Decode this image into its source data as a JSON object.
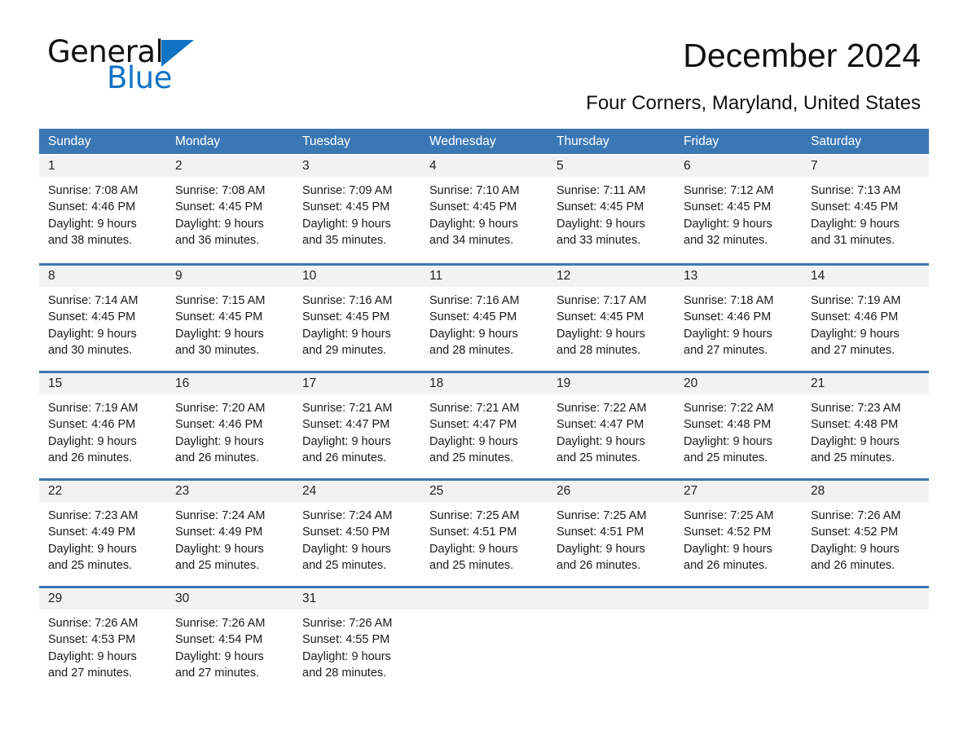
{
  "brand": {
    "name_top": "General",
    "name_bottom": "Blue",
    "accent_color": "#1273c4"
  },
  "header": {
    "title": "December 2024",
    "subtitle": "Four Corners, Maryland, United States"
  },
  "calendar": {
    "header_color": "#3b77b4",
    "daynum_bg": "#f2f2f2",
    "day_names": [
      "Sunday",
      "Monday",
      "Tuesday",
      "Wednesday",
      "Thursday",
      "Friday",
      "Saturday"
    ],
    "weeks": [
      [
        {
          "day": "1",
          "sunrise": "Sunrise: 7:08 AM",
          "sunset": "Sunset: 4:46 PM",
          "daylight_line1": "Daylight: 9 hours",
          "daylight_line2": "and 38 minutes."
        },
        {
          "day": "2",
          "sunrise": "Sunrise: 7:08 AM",
          "sunset": "Sunset: 4:45 PM",
          "daylight_line1": "Daylight: 9 hours",
          "daylight_line2": "and 36 minutes."
        },
        {
          "day": "3",
          "sunrise": "Sunrise: 7:09 AM",
          "sunset": "Sunset: 4:45 PM",
          "daylight_line1": "Daylight: 9 hours",
          "daylight_line2": "and 35 minutes."
        },
        {
          "day": "4",
          "sunrise": "Sunrise: 7:10 AM",
          "sunset": "Sunset: 4:45 PM",
          "daylight_line1": "Daylight: 9 hours",
          "daylight_line2": "and 34 minutes."
        },
        {
          "day": "5",
          "sunrise": "Sunrise: 7:11 AM",
          "sunset": "Sunset: 4:45 PM",
          "daylight_line1": "Daylight: 9 hours",
          "daylight_line2": "and 33 minutes."
        },
        {
          "day": "6",
          "sunrise": "Sunrise: 7:12 AM",
          "sunset": "Sunset: 4:45 PM",
          "daylight_line1": "Daylight: 9 hours",
          "daylight_line2": "and 32 minutes."
        },
        {
          "day": "7",
          "sunrise": "Sunrise: 7:13 AM",
          "sunset": "Sunset: 4:45 PM",
          "daylight_line1": "Daylight: 9 hours",
          "daylight_line2": "and 31 minutes."
        }
      ],
      [
        {
          "day": "8",
          "sunrise": "Sunrise: 7:14 AM",
          "sunset": "Sunset: 4:45 PM",
          "daylight_line1": "Daylight: 9 hours",
          "daylight_line2": "and 30 minutes."
        },
        {
          "day": "9",
          "sunrise": "Sunrise: 7:15 AM",
          "sunset": "Sunset: 4:45 PM",
          "daylight_line1": "Daylight: 9 hours",
          "daylight_line2": "and 30 minutes."
        },
        {
          "day": "10",
          "sunrise": "Sunrise: 7:16 AM",
          "sunset": "Sunset: 4:45 PM",
          "daylight_line1": "Daylight: 9 hours",
          "daylight_line2": "and 29 minutes."
        },
        {
          "day": "11",
          "sunrise": "Sunrise: 7:16 AM",
          "sunset": "Sunset: 4:45 PM",
          "daylight_line1": "Daylight: 9 hours",
          "daylight_line2": "and 28 minutes."
        },
        {
          "day": "12",
          "sunrise": "Sunrise: 7:17 AM",
          "sunset": "Sunset: 4:45 PM",
          "daylight_line1": "Daylight: 9 hours",
          "daylight_line2": "and 28 minutes."
        },
        {
          "day": "13",
          "sunrise": "Sunrise: 7:18 AM",
          "sunset": "Sunset: 4:46 PM",
          "daylight_line1": "Daylight: 9 hours",
          "daylight_line2": "and 27 minutes."
        },
        {
          "day": "14",
          "sunrise": "Sunrise: 7:19 AM",
          "sunset": "Sunset: 4:46 PM",
          "daylight_line1": "Daylight: 9 hours",
          "daylight_line2": "and 27 minutes."
        }
      ],
      [
        {
          "day": "15",
          "sunrise": "Sunrise: 7:19 AM",
          "sunset": "Sunset: 4:46 PM",
          "daylight_line1": "Daylight: 9 hours",
          "daylight_line2": "and 26 minutes."
        },
        {
          "day": "16",
          "sunrise": "Sunrise: 7:20 AM",
          "sunset": "Sunset: 4:46 PM",
          "daylight_line1": "Daylight: 9 hours",
          "daylight_line2": "and 26 minutes."
        },
        {
          "day": "17",
          "sunrise": "Sunrise: 7:21 AM",
          "sunset": "Sunset: 4:47 PM",
          "daylight_line1": "Daylight: 9 hours",
          "daylight_line2": "and 26 minutes."
        },
        {
          "day": "18",
          "sunrise": "Sunrise: 7:21 AM",
          "sunset": "Sunset: 4:47 PM",
          "daylight_line1": "Daylight: 9 hours",
          "daylight_line2": "and 25 minutes."
        },
        {
          "day": "19",
          "sunrise": "Sunrise: 7:22 AM",
          "sunset": "Sunset: 4:47 PM",
          "daylight_line1": "Daylight: 9 hours",
          "daylight_line2": "and 25 minutes."
        },
        {
          "day": "20",
          "sunrise": "Sunrise: 7:22 AM",
          "sunset": "Sunset: 4:48 PM",
          "daylight_line1": "Daylight: 9 hours",
          "daylight_line2": "and 25 minutes."
        },
        {
          "day": "21",
          "sunrise": "Sunrise: 7:23 AM",
          "sunset": "Sunset: 4:48 PM",
          "daylight_line1": "Daylight: 9 hours",
          "daylight_line2": "and 25 minutes."
        }
      ],
      [
        {
          "day": "22",
          "sunrise": "Sunrise: 7:23 AM",
          "sunset": "Sunset: 4:49 PM",
          "daylight_line1": "Daylight: 9 hours",
          "daylight_line2": "and 25 minutes."
        },
        {
          "day": "23",
          "sunrise": "Sunrise: 7:24 AM",
          "sunset": "Sunset: 4:49 PM",
          "daylight_line1": "Daylight: 9 hours",
          "daylight_line2": "and 25 minutes."
        },
        {
          "day": "24",
          "sunrise": "Sunrise: 7:24 AM",
          "sunset": "Sunset: 4:50 PM",
          "daylight_line1": "Daylight: 9 hours",
          "daylight_line2": "and 25 minutes."
        },
        {
          "day": "25",
          "sunrise": "Sunrise: 7:25 AM",
          "sunset": "Sunset: 4:51 PM",
          "daylight_line1": "Daylight: 9 hours",
          "daylight_line2": "and 25 minutes."
        },
        {
          "day": "26",
          "sunrise": "Sunrise: 7:25 AM",
          "sunset": "Sunset: 4:51 PM",
          "daylight_line1": "Daylight: 9 hours",
          "daylight_line2": "and 26 minutes."
        },
        {
          "day": "27",
          "sunrise": "Sunrise: 7:25 AM",
          "sunset": "Sunset: 4:52 PM",
          "daylight_line1": "Daylight: 9 hours",
          "daylight_line2": "and 26 minutes."
        },
        {
          "day": "28",
          "sunrise": "Sunrise: 7:26 AM",
          "sunset": "Sunset: 4:52 PM",
          "daylight_line1": "Daylight: 9 hours",
          "daylight_line2": "and 26 minutes."
        }
      ],
      [
        {
          "day": "29",
          "sunrise": "Sunrise: 7:26 AM",
          "sunset": "Sunset: 4:53 PM",
          "daylight_line1": "Daylight: 9 hours",
          "daylight_line2": "and 27 minutes."
        },
        {
          "day": "30",
          "sunrise": "Sunrise: 7:26 AM",
          "sunset": "Sunset: 4:54 PM",
          "daylight_line1": "Daylight: 9 hours",
          "daylight_line2": "and 27 minutes."
        },
        {
          "day": "31",
          "sunrise": "Sunrise: 7:26 AM",
          "sunset": "Sunset: 4:55 PM",
          "daylight_line1": "Daylight: 9 hours",
          "daylight_line2": "and 28 minutes."
        },
        {
          "day": "",
          "sunrise": "",
          "sunset": "",
          "daylight_line1": "",
          "daylight_line2": ""
        },
        {
          "day": "",
          "sunrise": "",
          "sunset": "",
          "daylight_line1": "",
          "daylight_line2": ""
        },
        {
          "day": "",
          "sunrise": "",
          "sunset": "",
          "daylight_line1": "",
          "daylight_line2": ""
        },
        {
          "day": "",
          "sunrise": "",
          "sunset": "",
          "daylight_line1": "",
          "daylight_line2": ""
        }
      ]
    ]
  }
}
